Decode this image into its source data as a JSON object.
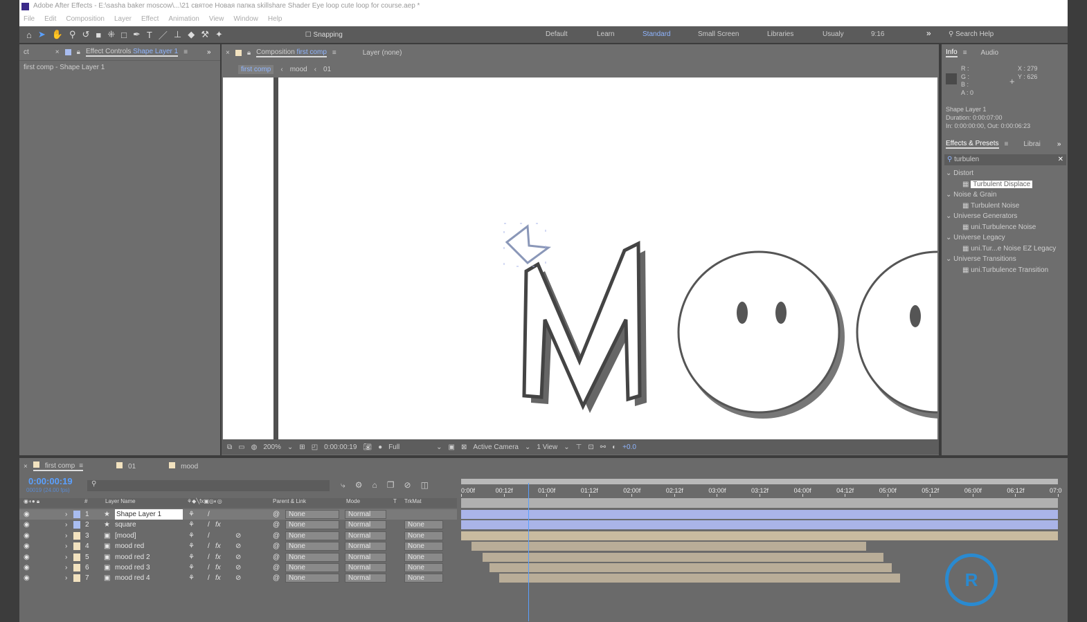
{
  "window": {
    "title": "Adobe After Effects - E:\\sasha baker moscow\\...\\21 святое Новая папка skillshare Shader Eye loop cute loop for course.aep *"
  },
  "menu": [
    "File",
    "Edit",
    "Composition",
    "Layer",
    "Effect",
    "Animation",
    "View",
    "Window",
    "Help"
  ],
  "toolbar": {
    "snapping": "Snapping",
    "workspaces": [
      "Default",
      "Learn",
      "Standard",
      "Small Screen",
      "Libraries",
      "Usualy",
      "9:16"
    ],
    "active_workspace": "Standard",
    "search_help": "Search Help"
  },
  "effect_controls": {
    "tab_prefix": "Effect Controls",
    "layer": "Shape Layer 1",
    "cut_tab": "ct",
    "breadcrumb": "first comp - Shape Layer 1"
  },
  "composition": {
    "tab_prefix": "Composition",
    "comp": "first comp",
    "layer_tab": "Layer (none)",
    "crumbs": [
      "first comp",
      "mood",
      "01"
    ]
  },
  "viewer": {
    "zoom": "200%",
    "timecode": "0:00:00:19",
    "resolution": "Full",
    "camera": "Active Camera",
    "views": "1 View",
    "exposure": "+0.0"
  },
  "info": {
    "tab": "Info",
    "audio_tab": "Audio",
    "r": "R :",
    "g": "G :",
    "b": "B :",
    "a": "A : 0",
    "x": "X : 279",
    "y": "Y : 626",
    "layer": "Shape Layer 1",
    "duration": "Duration: 0:00:07:00",
    "inout": "In: 0:00:00:00, Out: 0:00:06:23"
  },
  "effects": {
    "tab": "Effects & Presets",
    "libraries_tab": "Librai",
    "search": "turbulen",
    "groups": [
      {
        "name": "Distort",
        "item": "Turbulent Displace"
      },
      {
        "name": "Noise & Grain",
        "item": "Turbulent Noise"
      },
      {
        "name": "Universe Generators",
        "item": "uni.Turbulence Noise"
      },
      {
        "name": "Universe Legacy",
        "item": "uni.Tur...e Noise EZ Legacy"
      },
      {
        "name": "Universe Transitions",
        "item": "uni.Turbulence Transition"
      }
    ]
  },
  "timeline": {
    "tabs": [
      "first comp",
      "01",
      "mood"
    ],
    "timecode": "0:00:00:19",
    "frames": "00019 (24.00 fps)",
    "headers": {
      "num": "#",
      "name": "Layer Name",
      "parent": "Parent & Link",
      "mode": "Mode",
      "t": "T",
      "trkmat": "TrkMat"
    },
    "ruler": [
      "0:00f",
      "00:12f",
      "01:00f",
      "01:12f",
      "02:00f",
      "02:12f",
      "03:00f",
      "03:12f",
      "04:00f",
      "04:12f",
      "05:00f",
      "05:12f",
      "06:00f",
      "06:12f",
      "07:0"
    ],
    "current_time_seconds": 0.79,
    "layers": [
      {
        "num": "1",
        "name": "Shape Layer 1",
        "type": "shape",
        "label": "#a9bdf0",
        "parent": "None",
        "mode": "Normal",
        "trkmat": "",
        "fx": false,
        "bar_color": "#aab4e8",
        "start": 0,
        "end": 7
      },
      {
        "num": "2",
        "name": "square",
        "type": "shape",
        "label": "#a9bdf0",
        "parent": "None",
        "mode": "Normal",
        "trkmat": "None",
        "fx": true,
        "bar_color": "#aab4e8",
        "start": 0,
        "end": 7
      },
      {
        "num": "3",
        "name": "[mood]",
        "type": "comp",
        "label": "#f2e2bf",
        "parent": "None",
        "mode": "Normal",
        "trkmat": "None",
        "fx": false,
        "bar_color": "#c9bba0",
        "start": 0,
        "end": 7
      },
      {
        "num": "4",
        "name": "mood red",
        "type": "comp",
        "label": "#f2e2bf",
        "parent": "None",
        "mode": "Normal",
        "trkmat": "None",
        "fx": true,
        "bar_color": "#b9ad98",
        "start": 0.12,
        "end": 4.75
      },
      {
        "num": "5",
        "name": "mood red 2",
        "type": "comp",
        "label": "#f2e2bf",
        "parent": "None",
        "mode": "Normal",
        "trkmat": "None",
        "fx": true,
        "bar_color": "#b9ad98",
        "start": 0.25,
        "end": 4.95
      },
      {
        "num": "6",
        "name": "mood red 3",
        "type": "comp",
        "label": "#f2e2bf",
        "parent": "None",
        "mode": "Normal",
        "trkmat": "None",
        "fx": true,
        "bar_color": "#b9ad98",
        "start": 0.33,
        "end": 5.05
      },
      {
        "num": "7",
        "name": "mood red 4",
        "type": "comp",
        "label": "#f2e2bf",
        "parent": "None",
        "mode": "Normal",
        "trkmat": "None",
        "fx": true,
        "bar_color": "#b9ad98",
        "start": 0.45,
        "end": 5.15
      }
    ]
  },
  "colors": {
    "accent": "#8fb5ff",
    "timecode": "#5aa0ff"
  }
}
